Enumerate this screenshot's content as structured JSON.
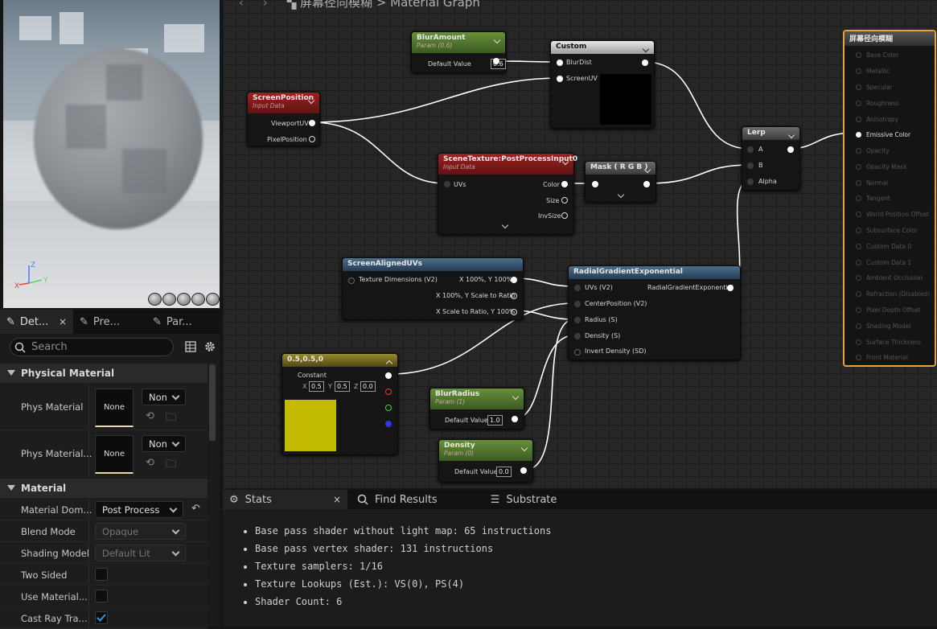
{
  "breadcrumb": {
    "asset": "屏幕径向模糊",
    "sep": ">",
    "graph": "Material Graph"
  },
  "details": {
    "tabs": [
      {
        "label": "Det...",
        "close": "×"
      },
      {
        "label": "Pre..."
      },
      {
        "label": "Par..."
      }
    ],
    "search_placeholder": "Search",
    "cat_physical": "Physical Material",
    "phys_material_label": "Phys Material",
    "phys_material_value": "None",
    "phys_material_dd": "Non",
    "phys_material2_label": "Phys Material...",
    "phys_material2_value": "None",
    "phys_material2_dd": "Non",
    "cat_material": "Material",
    "material_domain_label": "Material Dom...",
    "material_domain_value": "Post Process",
    "blend_mode_label": "Blend Mode",
    "blend_mode_value": "Opaque",
    "shading_model_label": "Shading Model",
    "shading_model_value": "Default Lit",
    "two_sided_label": "Two Sided",
    "use_material_label": "Use Material...",
    "cast_ray_label": "Cast Ray Tra..."
  },
  "nodes": {
    "blur_amount": {
      "title": "BlurAmount",
      "subtitle": "Param (0.6)",
      "pin": "Default Value",
      "value": "0.6"
    },
    "custom": {
      "title": "Custom",
      "pins": [
        "BlurDist",
        "ScreenUV"
      ]
    },
    "screen_position": {
      "title": "ScreenPosition",
      "subtitle": "Input Data",
      "pins": [
        "ViewportUV",
        "PixelPosition"
      ]
    },
    "scene_texture": {
      "title": "SceneTexture:PostProcessInput0",
      "subtitle": "Input Data",
      "in": "UVs",
      "outs": [
        "Color",
        "Size",
        "InvSize"
      ]
    },
    "mask": {
      "title": "Mask ( R G B )"
    },
    "lerp": {
      "title": "Lerp",
      "pins": [
        "A",
        "B",
        "Alpha"
      ]
    },
    "screen_aligned": {
      "title": "ScreenAlignedUVs",
      "in": "Texture Dimensions (V2)",
      "outs": [
        "X 100%, Y 100%",
        "X 100%, Y Scale to Ratio",
        "X Scale to Ratio, Y 100%"
      ]
    },
    "radial": {
      "title": "RadialGradientExponential",
      "ins": [
        "UVs (V2)",
        "CenterPosition (V2)",
        "Radius (S)",
        "Density (S)",
        "Invert Density (SD)"
      ],
      "out": "RadialGradientExponential"
    },
    "constant": {
      "title": "0.5,0.5,0",
      "label": "Constant",
      "x": "0.5",
      "y": "0.5",
      "z": "0.0",
      "xl": "X",
      "yl": "Y",
      "zl": "Z",
      "color": "#c2bb00"
    },
    "blur_radius": {
      "title": "BlurRadius",
      "subtitle": "Param (1)",
      "pin": "Default Value",
      "value": "1.0"
    },
    "density": {
      "title": "Density",
      "subtitle": "Param (0)",
      "pin": "Default Value",
      "value": "0.0"
    }
  },
  "result": {
    "title": "屏幕径向模糊",
    "pins": [
      "Base Color",
      "Metallic",
      "Specular",
      "Roughness",
      "Anisotropy",
      "Emissive Color",
      "Opacity",
      "Opacity Mask",
      "Normal",
      "Tangent",
      "World Position Offset",
      "Subsurface Color",
      "Custom Data 0",
      "Custom Data 1",
      "Ambient Occlusion",
      "Refraction (Disabled)",
      "Pixel Depth Offset",
      "Shading Model",
      "Surface Thickness",
      "Front Material"
    ]
  },
  "bottom": {
    "tabs": [
      {
        "label": "Stats",
        "close": "×"
      },
      {
        "label": "Find Results"
      },
      {
        "label": "Substrate"
      }
    ],
    "stats": [
      "Base pass shader without light map: 65 instructions",
      "Base pass vertex shader: 131 instructions",
      "Texture samplers: 1/16",
      "Texture Lookups (Est.): VS(0), PS(4)",
      "Shader Count: 6"
    ]
  },
  "colors": {
    "accent_orange": "#e8a23a",
    "checkbox_check": "#3b8fd9"
  }
}
